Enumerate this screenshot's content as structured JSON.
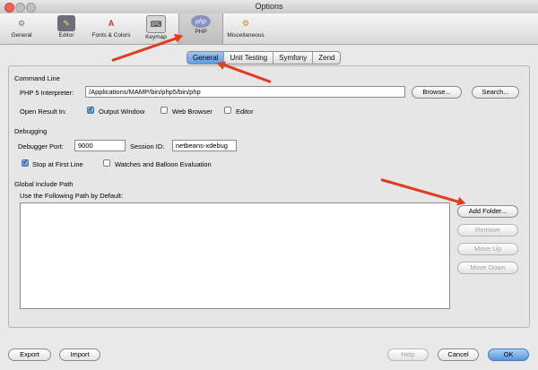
{
  "window": {
    "title": "Options"
  },
  "toolbar": {
    "items": [
      {
        "label": "General",
        "icon": "general-icon"
      },
      {
        "label": "Editor",
        "icon": "editor-icon"
      },
      {
        "label": "Fonts & Colors",
        "icon": "fonts-colors-icon"
      },
      {
        "label": "Keymap",
        "icon": "keymap-icon"
      },
      {
        "label": "PHP",
        "icon": "php-icon",
        "active": true
      },
      {
        "label": "Miscellaneous",
        "icon": "miscellaneous-icon"
      }
    ]
  },
  "tabs": [
    {
      "label": "General",
      "selected": true
    },
    {
      "label": "Unit Testing"
    },
    {
      "label": "Symfony"
    },
    {
      "label": "Zend"
    }
  ],
  "command_line": {
    "section_title": "Command Line",
    "interpreter_label": "PHP 5 Interpreter:",
    "interpreter_value": "/Applications/MAMP/bin/php5/bin/php",
    "browse_label": "Browse...",
    "search_label": "Search...",
    "open_result_label": "Open Result In:",
    "output_window_label": "Output Window",
    "web_browser_label": "Web Browser",
    "editor_label": "Editor"
  },
  "debugging": {
    "section_title": "Debugging",
    "port_label": "Debugger Port:",
    "port_value": "9000",
    "session_label": "Session ID:",
    "session_value": "netbeans-xdebug",
    "stop_first_line_label": "Stop at First Line",
    "watches_label": "Watches and Balloon Evaluation"
  },
  "include_path": {
    "section_title": "Global Include Path",
    "use_path_label": "Use the Following Path by Default:",
    "add_folder_label": "Add Folder...",
    "remove_label": "Remove",
    "move_up_label": "Move Up",
    "move_down_label": "Move Down"
  },
  "footer": {
    "export_label": "Export",
    "import_label": "Import",
    "help_label": "Help",
    "cancel_label": "Cancel",
    "ok_label": "OK"
  },
  "colors": {
    "accent": "#5f9be0",
    "annotation": "#e23b1f"
  }
}
